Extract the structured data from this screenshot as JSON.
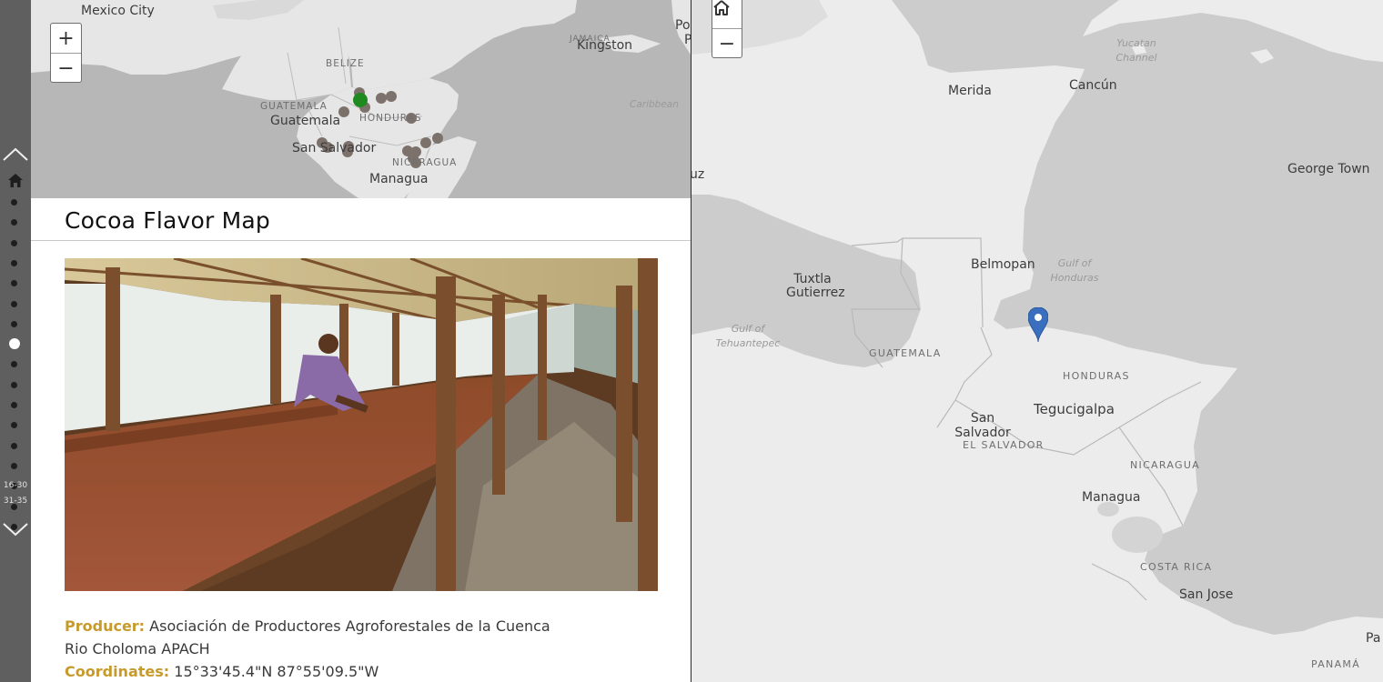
{
  "rail": {
    "range_primary": "16-30",
    "range_secondary": "31-35",
    "dot_count": 17,
    "active_index": 7
  },
  "panel": {
    "title": "Cocoa Flavor Map",
    "producer_label": "Producer:",
    "producer_value": "Asociación de Productores Agroforestales de la Cuenca Rio Choloma APACH",
    "coordinates_label": "Coordinates:",
    "coordinates_value": "15°33'45.4\"N 87°55'09.5\"W"
  },
  "mini_map": {
    "cities": [
      "Mexico City",
      "Kingston",
      "Guatemala",
      "San Salvador",
      "Managua"
    ],
    "countries": [
      "BELIZE",
      "GUATEMALA",
      "HONDURAS",
      "NICARAGUA",
      "JAMAICA"
    ],
    "water": [
      "Caribbean"
    ],
    "partials": [
      "Po",
      "P"
    ],
    "marker_colors": {
      "default": "#7d726b",
      "selected": "#1f8a1f"
    }
  },
  "main_map": {
    "cities": [
      "Merida",
      "Cancún",
      "George Town",
      "Belmopan",
      "Tuxtla Gutierrez",
      "Tegucigalpa",
      "San Salvador",
      "Managua",
      "San Jose"
    ],
    "countries": [
      "GUATEMALA",
      "HONDURAS",
      "EL SALVADOR",
      "NICARAGUA",
      "COSTA RICA",
      "PANAMÁ"
    ],
    "water": [
      "Yucatan Channel",
      "Gulf of Honduras",
      "Gulf of Tehuantepec"
    ],
    "partials": [
      "uz",
      "Pa"
    ],
    "pin_color": "#3a6fbf"
  },
  "icons": {
    "zoom_in": "plus-icon",
    "zoom_out": "minus-icon",
    "home": "home-icon",
    "prev": "chevron-up-icon",
    "next": "chevron-down-icon"
  }
}
